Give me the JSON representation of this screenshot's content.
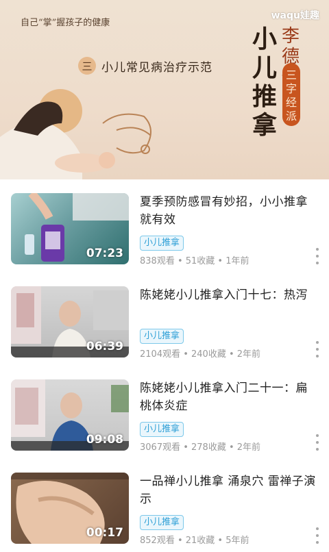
{
  "banner": {
    "slogan": "自己“掌”握孩子的健康",
    "number_badge": "三",
    "subtitle": "小儿常见病治疗示范",
    "vertical_title": "小儿推拿",
    "vertical_tag": "李德修",
    "seal_text": "三字经派",
    "watermark": "waqu娃趣"
  },
  "videos": [
    {
      "title": "夏季预防感冒有妙招，小小推拿就有效",
      "tag": "小儿推拿",
      "stats": "838观看 • 51收藏 • 1年前",
      "duration": "07:23"
    },
    {
      "title": "陈姥姥小儿推拿入门十七：热泻",
      "tag": "小儿推拿",
      "stats": "2104观看 • 240收藏 • 2年前",
      "duration": "06:39"
    },
    {
      "title": "陈姥姥小儿推拿入门二十一：扁桃体炎症",
      "tag": "小儿推拿",
      "stats": "3067观看 • 278收藏 • 2年前",
      "duration": "09:08"
    },
    {
      "title": "一品禅小儿推拿 涌泉穴 雷禅子演示",
      "tag": "小儿推拿",
      "stats": "852观看 • 21收藏 • 5年前",
      "duration": "00:17"
    }
  ]
}
